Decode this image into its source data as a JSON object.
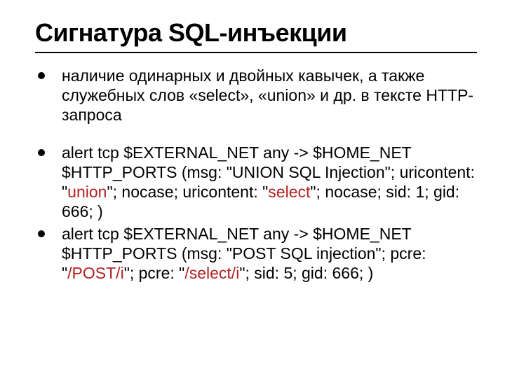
{
  "title": "Сигнатура SQL-инъекции",
  "bullet1": "наличие одинарных и двойных кавычек, а также служебных слов «select», «union» и др. в тексте HTTP-запроса",
  "bullet2": {
    "p1": "alert tcp $EXTERNAL_NET any -> $HOME_NET $HTTP_PORTS (msg: \"UNION SQL Injection\"; uricontent: \"",
    "kw1": "union",
    "p2": "\"; nocase; uricontent: \"",
    "kw2": "select",
    "p3": "\"; nocase; sid: 1; gid: 666; )"
  },
  "bullet3": {
    "p1": "alert tcp $EXTERNAL_NET any -> $HOME_NET $HTTP_PORTS (msg: \"POST SQL injection\"; pcre: \"",
    "kw1": "/POST/i",
    "p2": "\"; pcre: \"",
    "kw2": "/select/i",
    "p3": "\"; sid: 5; gid: 666; )"
  }
}
